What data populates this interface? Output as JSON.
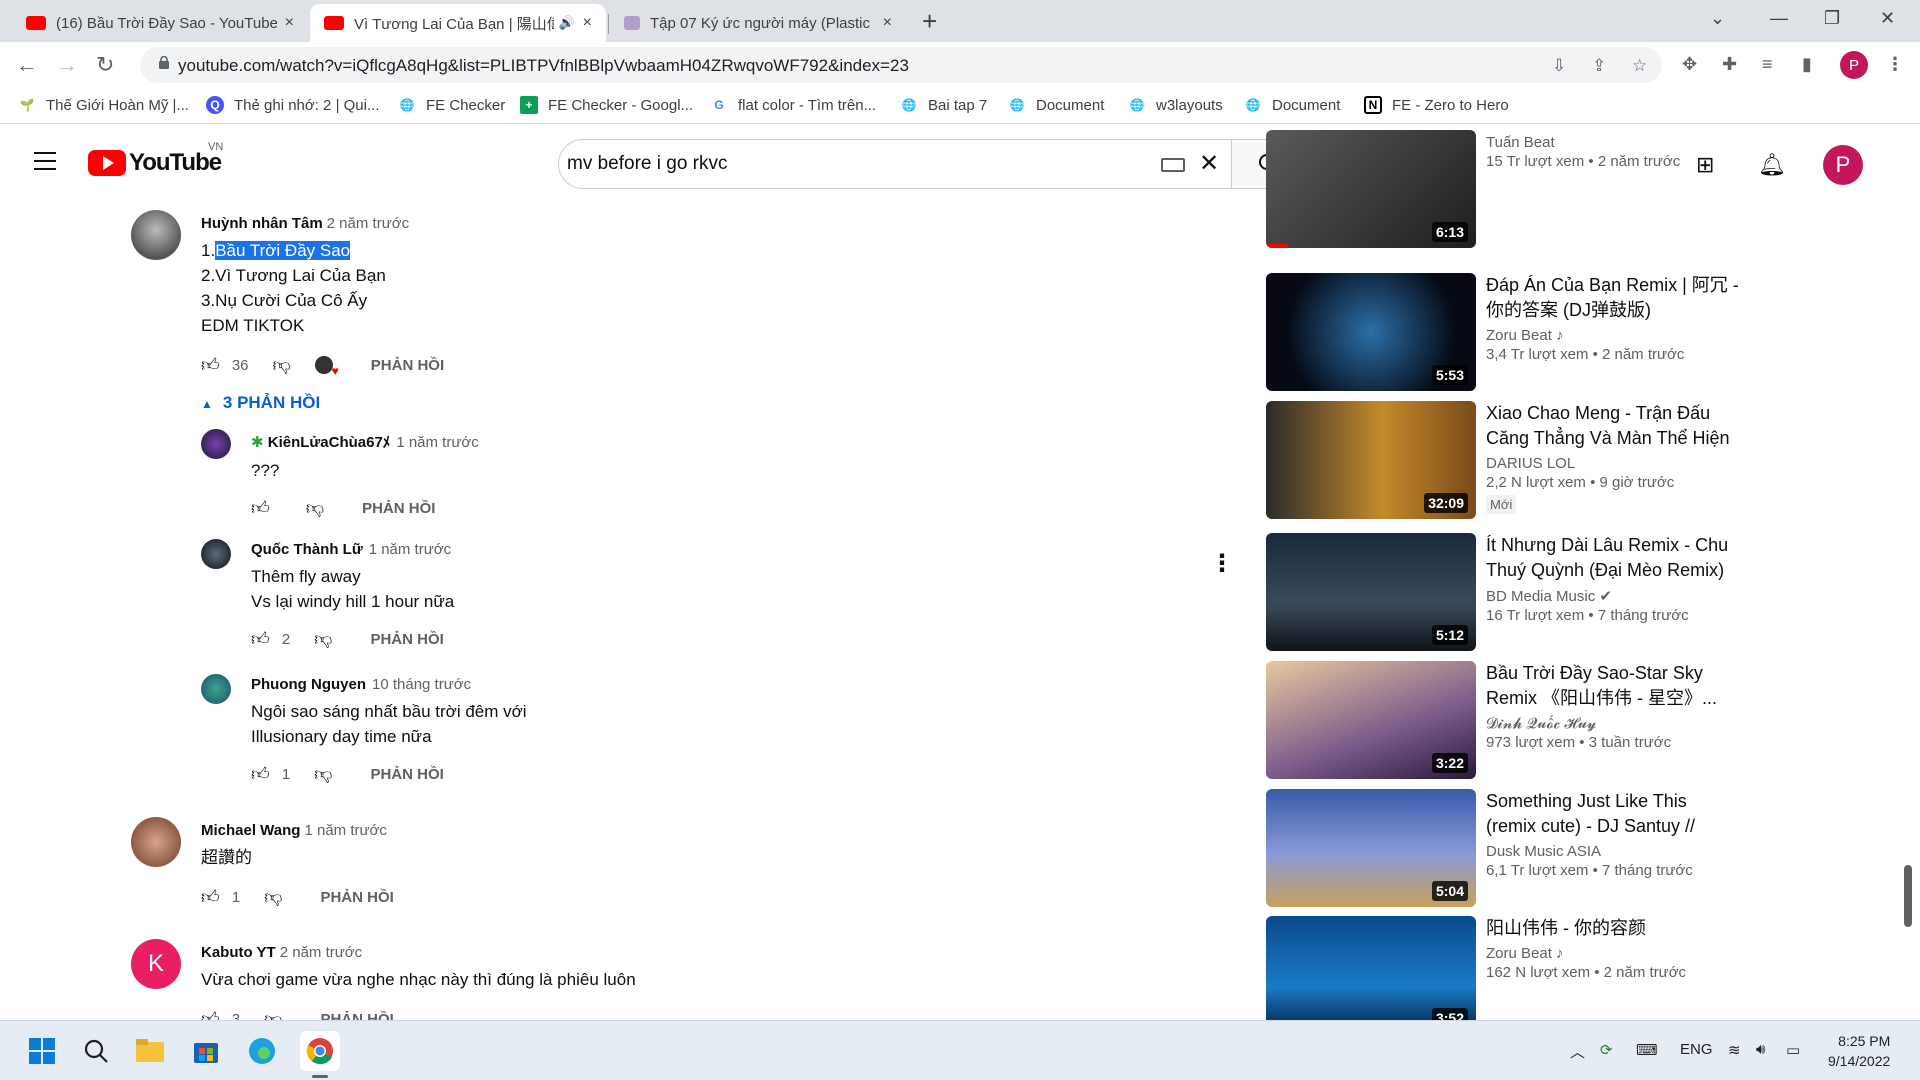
{
  "browser": {
    "tabs": [
      {
        "title": "(16) Bầu Trời Đầy Sao - YouTube",
        "close": "×"
      },
      {
        "title": "Vì Tương Lai Của Bạn | 陽山偉",
        "close": "×"
      },
      {
        "title": "Tập 07 Ký ức người máy (Plastic M",
        "close": "×"
      }
    ],
    "new_tab": "+",
    "url": "youtube.com/watch?v=iQflcgA8qHg&list=PLIBTPVfnlBBlpVwbaamH04ZRwqvoWF792&index=23",
    "profile_initial": "P",
    "bookmarks": [
      {
        "label": "Thế Giới Hoàn Mỹ |...",
        "icon": "🌱",
        "color": "#2e7d32"
      },
      {
        "label": "Thẻ ghi nhớ: 2 | Qui...",
        "icon": "Q",
        "color": "#4255ff"
      },
      {
        "label": "FE Checker",
        "icon": "🌐",
        "color": "#5f6368"
      },
      {
        "label": "FE Checker - Googl...",
        "icon": "+",
        "color": "#0f9d58"
      },
      {
        "label": "flat color - Tìm trên...",
        "icon": "G",
        "color": "#4285f4"
      },
      {
        "label": "Bai tap 7",
        "icon": "🌐",
        "color": "#5f6368"
      },
      {
        "label": "Document",
        "icon": "🌐",
        "color": "#5f6368"
      },
      {
        "label": "w3layouts",
        "icon": "🌐",
        "color": "#5f6368"
      },
      {
        "label": "Document",
        "icon": "🌐",
        "color": "#5f6368"
      },
      {
        "label": "FE - Zero to Hero",
        "icon": "N",
        "color": "#000000"
      }
    ]
  },
  "youtube": {
    "logo_text": "YouTube",
    "country": "VN",
    "search_query": "mv before i go rkvc",
    "header_avatar": "P"
  },
  "comments": {
    "main": {
      "author": "Huỳnh nhân Tâm",
      "time": "2 năm trước",
      "line1_prefix": "1.",
      "line1_selected": "Bầu Trời Đầy Sao",
      "line2": "2.Vì Tương Lai Của Bạn",
      "line3": "3.Nụ Cười Của Cô Ấy",
      "line4": "EDM TIKTOK",
      "likes": "36",
      "reply_label": "PHẢN HỒI",
      "replies_toggle": "3 PHẢN HỒI"
    },
    "replies": [
      {
        "author": "KiênLửaChùa67ﾒ",
        "time": "1 năm trước",
        "lines": [
          "???"
        ],
        "likes": "",
        "reply_label": "PHẢN HỒI"
      },
      {
        "author": "Quốc Thành Lữ",
        "time": "1 năm trước",
        "lines": [
          "Thêm fly away",
          "Vs lại windy hill 1 hour nữa"
        ],
        "likes": "2",
        "reply_label": "PHẢN HỒI"
      },
      {
        "author": "Phuong Nguyen",
        "time": "10 tháng trước",
        "lines": [
          "Ngôi sao sáng nhất bầu trời đêm với",
          "Illusionary day time nữa"
        ],
        "likes": "1",
        "reply_label": "PHẢN HỒI"
      }
    ],
    "others": [
      {
        "author": "Michael Wang",
        "time": "1 năm trước",
        "text": "超讚的",
        "likes": "1",
        "reply_label": "PHẢN HỒI"
      },
      {
        "author": "Kabuto YT",
        "time": "2 năm trước",
        "text": "Vừa chơi game vừa nghe nhạc này thì đúng là phiêu luôn",
        "likes": "3",
        "reply_label": "PHẢN HỒI",
        "avatar_letter": "K"
      }
    ]
  },
  "sidebar": {
    "videos": [
      {
        "title": "",
        "channel": "Tuấn Beat",
        "stats": "15 Tr lượt xem • 2 năm trước",
        "duration": "6:13"
      },
      {
        "title": "Đáp Án Của Bạn Remix | 阿冗 - 你的答案 (DJ弹鼓版)",
        "channel": "Zoru Beat ♪",
        "stats": "3,4 Tr lượt xem • 2 năm trước",
        "duration": "5:53"
      },
      {
        "title": "Xiao Chao Meng - Trận Đấu Căng Thẳng Và Màn Thể Hiện ...",
        "channel": "DARIUS LOL",
        "stats": "2,2 N lượt xem • 9 giờ trước",
        "badge": "Mới",
        "duration": "32:09"
      },
      {
        "title": "Ít Nhưng Dài Lâu Remix - Chu Thuý Quỳnh (Đại Mèo Remix) Í...",
        "channel": "BD Media Music ✔",
        "stats": "16 Tr lượt xem • 7 tháng trước",
        "duration": "5:12"
      },
      {
        "title": "Bầu Trời Đầy Sao-Star Sky Remix 《阳山伟伟 - 星空》...",
        "channel": "𝓓𝓲𝓷𝓱 𝓠𝓾𝓸̂́𝓬 𝓗𝓾𝔂",
        "stats": "973 lượt xem • 3 tuần trước",
        "duration": "3:22"
      },
      {
        "title": "Something Just Like This (remix cute) - DJ Santuy // (Vietsub +...",
        "channel": "Dusk Music ASIA",
        "stats": "6,1 Tr lượt xem • 7 tháng trước",
        "duration": "5:04"
      },
      {
        "title": "阳山伟伟 - 你的容颜",
        "channel": "Zoru Beat ♪",
        "stats": "162 N lượt xem • 2 năm trước",
        "duration": "3:52"
      }
    ]
  },
  "taskbar": {
    "lang": "ENG",
    "time": "8:25 PM",
    "date": "9/14/2022"
  }
}
